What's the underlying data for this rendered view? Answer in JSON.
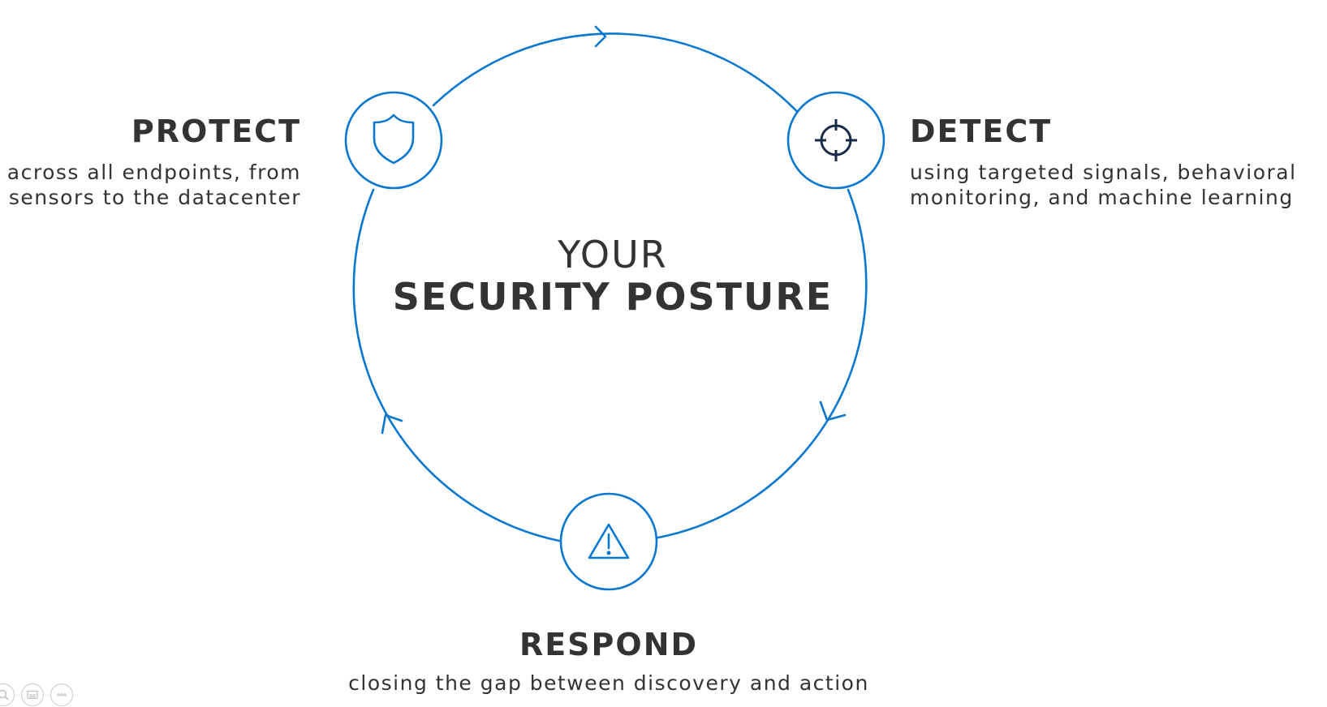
{
  "center": {
    "line1": "YOUR",
    "line2": "SECURITY POSTURE"
  },
  "stages": {
    "protect": {
      "title": "PROTECT",
      "desc_line1": "across all endpoints, from",
      "desc_line2": "sensors to the datacenter",
      "icon": "shield-icon"
    },
    "detect": {
      "title": "DETECT",
      "desc_line1": "using targeted signals, behavioral",
      "desc_line2": "monitoring, and machine learning",
      "icon": "crosshair-icon"
    },
    "respond": {
      "title": "RESPOND",
      "desc_line1": "closing the gap between discovery and action",
      "icon": "warning-icon"
    }
  },
  "toolbar": {
    "icons": [
      "zoom-icon",
      "subtitles-icon",
      "more-options-icon"
    ]
  },
  "colors": {
    "accent": "#0b78d0",
    "text": "#333333",
    "icon_dark": "#1a2a4a"
  }
}
